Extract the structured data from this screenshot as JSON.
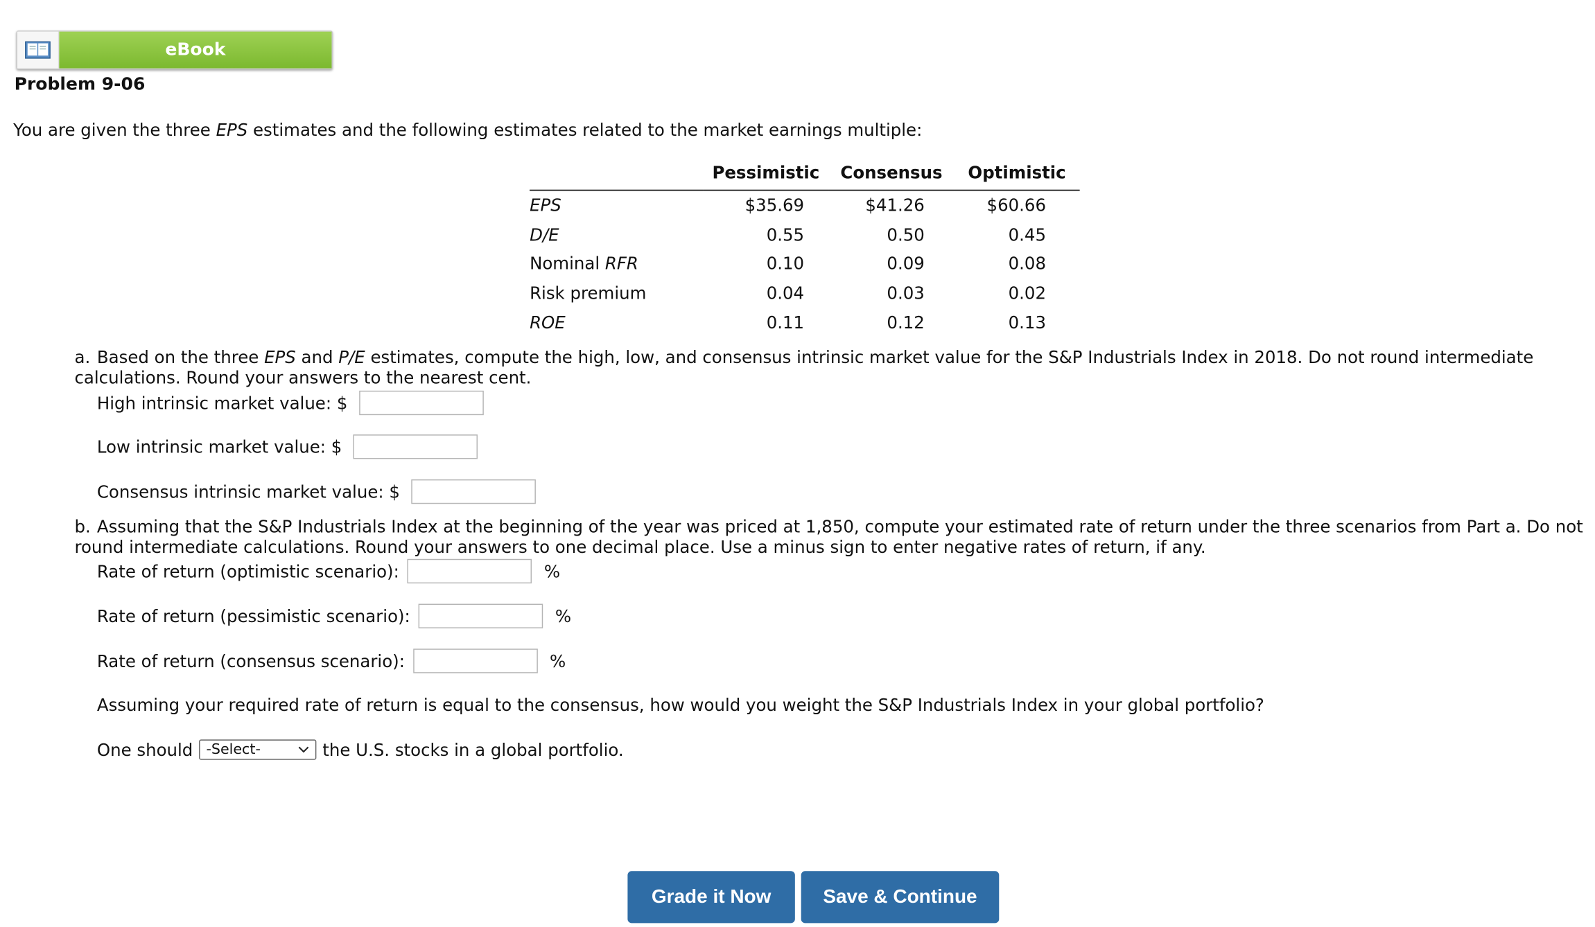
{
  "ebook": {
    "label": "eBook",
    "icon": "open-book-icon"
  },
  "problem": {
    "title": "Problem 9-06"
  },
  "intro": {
    "before": "You are given the three ",
    "term": "EPS",
    "after": " estimates and the following estimates related to the market earnings multiple:"
  },
  "table": {
    "headers": [
      "Pessimistic",
      "Consensus",
      "Optimistic"
    ],
    "rows": [
      {
        "label_pre": "",
        "label_em": "EPS",
        "values": [
          "$35.69",
          "$41.26",
          "$60.66"
        ]
      },
      {
        "label_pre": "",
        "label_em": "D/E",
        "values": [
          "0.55",
          "0.50",
          "0.45"
        ]
      },
      {
        "label_pre": "Nominal ",
        "label_em": "RFR",
        "values": [
          "0.10",
          "0.09",
          "0.08"
        ]
      },
      {
        "label_pre": "Risk premium",
        "label_em": "",
        "values": [
          "0.04",
          "0.03",
          "0.02"
        ]
      },
      {
        "label_pre": "",
        "label_em": "ROE",
        "values": [
          "0.11",
          "0.12",
          "0.13"
        ]
      }
    ]
  },
  "part_a": {
    "letter": "a.",
    "text_1": "Based on the three ",
    "em_1": "EPS",
    "text_2": " and ",
    "em_2": "P/E",
    "text_3": " estimates, compute the high, low, and consensus intrinsic market value for the S&P Industrials Index in 2018. Do not round intermediate calculations. Round your answers to the nearest cent.",
    "high_label": "High intrinsic market value: $",
    "low_label": "Low intrinsic market value: $",
    "consensus_label": "Consensus intrinsic market value: $"
  },
  "part_b": {
    "letter": "b.",
    "text": "Assuming that the S&P Industrials Index at the beginning of the year was priced at 1,850, compute your estimated rate of return under the three scenarios from Part a. Do not round intermediate calculations. Round your answers to one decimal place. Use a minus sign to enter negative rates of return, if any.",
    "optimistic_label": "Rate of return (optimistic scenario):",
    "pessimistic_label": "Rate of return (pessimistic scenario):",
    "consensus_label": "Rate of return (consensus scenario):",
    "percent": "%",
    "weight_question": "Assuming your required rate of return is equal to the consensus, how would you weight the S&P Industrials Index in your global portfolio?",
    "should_pre": "One should",
    "select_value": "-Select-",
    "should_post": "the U.S. stocks in a global portfolio."
  },
  "buttons": {
    "grade": "Grade it Now",
    "save": "Save & Continue"
  },
  "colors": {
    "ebook_green": "#7cb92f",
    "button_blue": "#2f6da6"
  }
}
